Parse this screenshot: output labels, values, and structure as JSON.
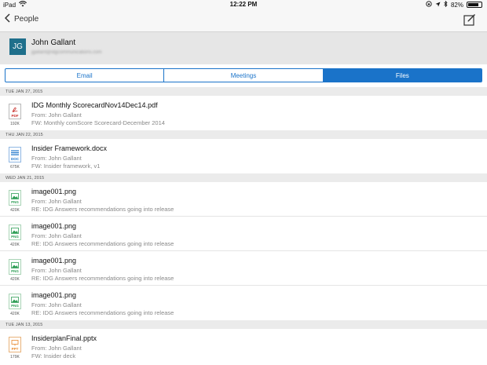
{
  "status_bar": {
    "device": "iPad",
    "time": "12:22 PM",
    "battery": "82%",
    "battery_level": 0.82
  },
  "nav": {
    "back_label": "People"
  },
  "contact": {
    "initials": "JG",
    "name": "John Gallant",
    "email": "jgallant@idgcommunications.com"
  },
  "tabs": [
    {
      "label": "Email",
      "active": false
    },
    {
      "label": "Meetings",
      "active": false
    },
    {
      "label": "Files",
      "active": true
    }
  ],
  "groups": [
    {
      "date": "TUE JAN 27, 2015",
      "files": [
        {
          "name": "IDG Monthly ScorecardNov14Dec14.pdf",
          "type": "PDF",
          "size": "192K",
          "from": "From: John Gallant",
          "subject": "FW: Monthly comScore Scorecard-December 2014"
        }
      ]
    },
    {
      "date": "THU JAN 22, 2015",
      "files": [
        {
          "name": "Insider Framework.docx",
          "type": "DOC",
          "size": "675K",
          "from": "From: John Gallant",
          "subject": "FW: Insider framework, v1"
        }
      ]
    },
    {
      "date": "WED JAN 21, 2015",
      "files": [
        {
          "name": "image001.png",
          "type": "PNG",
          "size": "420K",
          "from": "From: John Gallant",
          "subject": "RE: IDG Answers recommendations going into release"
        },
        {
          "name": "image001.png",
          "type": "PNG",
          "size": "420K",
          "from": "From: John Gallant",
          "subject": "RE: IDG Answers recommendations going into release"
        },
        {
          "name": "image001.png",
          "type": "PNG",
          "size": "420K",
          "from": "From: John Gallant",
          "subject": "RE: IDG Answers recommendations going into release"
        },
        {
          "name": "image001.png",
          "type": "PNG",
          "size": "420K",
          "from": "From: John Gallant",
          "subject": "RE: IDG Answers recommendations going into release"
        }
      ]
    },
    {
      "date": "TUE JAN 13, 2015",
      "files": [
        {
          "name": "InsiderplanFinal.pptx",
          "type": "PPT",
          "size": "179K",
          "from": "From: John Gallant",
          "subject": "FW: Insider deck"
        }
      ]
    }
  ],
  "colors": {
    "accent": "#1a73c9",
    "avatar": "#1f6f8b",
    "pdf": "#c9302c",
    "doc": "#1a73c9",
    "png": "#2f9e56",
    "ppt": "#e8862a"
  }
}
